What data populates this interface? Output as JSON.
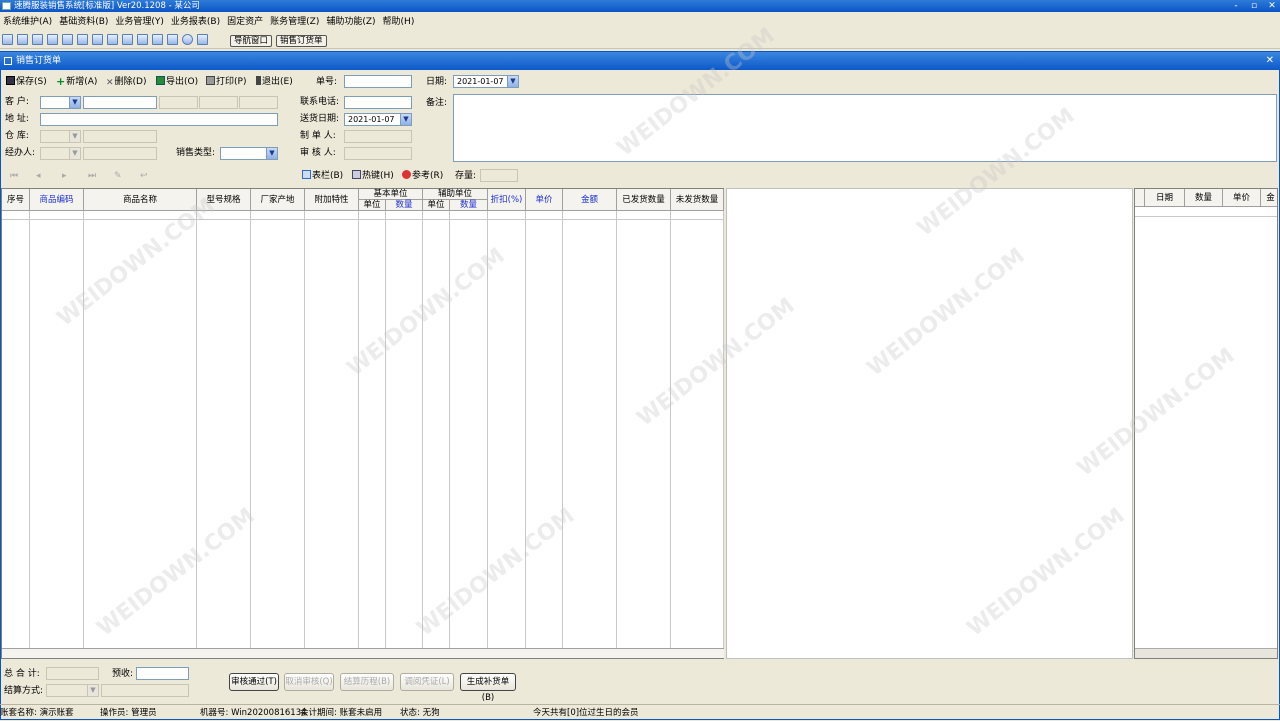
{
  "window": {
    "title": "速腾服装销售系统[标准版] Ver20.1208 - 某公司",
    "min": "-",
    "max": "▫",
    "close": "✕"
  },
  "menu": [
    "系统维护(A)",
    "基础资料(B)",
    "业务管理(Y)",
    "业务报表(B)",
    "固定资产",
    "账务管理(Z)",
    "辅助功能(Z)",
    "帮助(H)"
  ],
  "toolbar": {
    "nav_window": "导航窗口",
    "sales_order": "销售订货单"
  },
  "doc": {
    "title": "销售订货单",
    "close": "✕"
  },
  "actions": {
    "save": "保存(S)",
    "new": "新增(A)",
    "delete": "删除(D)",
    "export": "导出(O)",
    "print": "打印(P)",
    "exit": "退出(E)"
  },
  "form": {
    "order_no_label": "单号:",
    "order_no": "",
    "date_label": "日期:",
    "date": "2021-01-07",
    "customer_label": "客  户:",
    "address_label": "地  址:",
    "warehouse_label": "仓  库:",
    "handler_label": "经办人:",
    "sales_type_label": "销售类型:",
    "phone_label": "联系电话:",
    "delivery_date_label": "送货日期:",
    "delivery_date": "2021-01-07",
    "maker_label": "制 单 人:",
    "reviewer_label": "审 核 人:",
    "remark_label": "备注:"
  },
  "subtools": {
    "columns": "表栏(B)",
    "hotkey": "热键(H)",
    "ref": "参考(R)",
    "stock_label": "存量:"
  },
  "grid": {
    "columns": [
      "序号",
      "商品编码",
      "商品名称",
      "型号规格",
      "厂家产地",
      "附加特性",
      "单位",
      "数量",
      "单位",
      "数量",
      "折扣(%)",
      "单价",
      "金额",
      "已发货数量",
      "未发货数量"
    ],
    "group_base": "基本单位",
    "group_aux": "辅助单位"
  },
  "right_grid": {
    "columns": [
      "日期",
      "数量",
      "单价",
      "金"
    ]
  },
  "footer": {
    "total_label": "总 合 计:",
    "prepaid_label": "预收:",
    "settle_label": "结算方式:",
    "approve": "审核通过(T)",
    "cancel_approve": "取消审核(Q)",
    "settle_history": "结算历程(B)",
    "view_voucher": "调阅凭证(L)",
    "gen_replenish": "生成补货单(B)"
  },
  "status": {
    "account": "账套名称: 演示账套",
    "operator": "操作员: 管理员",
    "machine": "机器号: Win20200816134",
    "period": "会计期间: 账套未启用",
    "state": "状态: 无狗",
    "birthday": "今天共有[0]位过生日的会员"
  },
  "watermark": "WEIDOWN.COM"
}
